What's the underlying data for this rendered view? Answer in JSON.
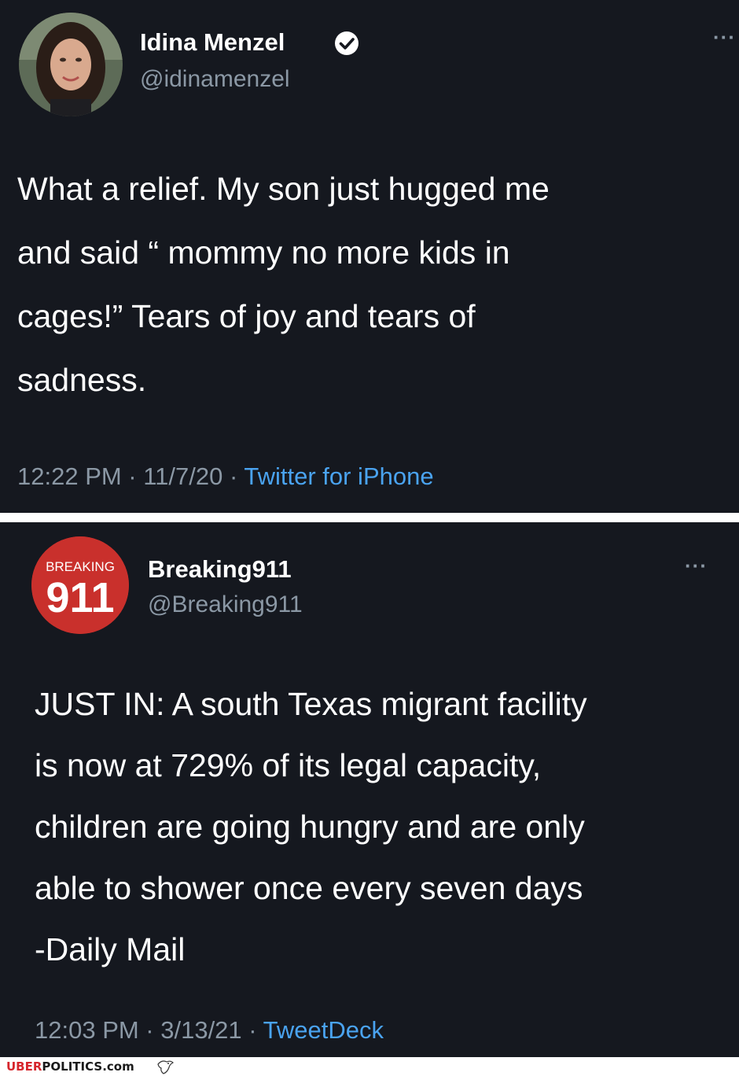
{
  "tweets": [
    {
      "display_name": "Idina Menzel",
      "handle": "@idinamenzel",
      "verified": true,
      "text": "What a relief.  My son just hugged me\nand said “ mommy no more kids in\ncages!” Tears of joy and tears of\nsadness.",
      "time": "12:22 PM · 11/7/20 · ",
      "source": "Twitter for iPhone",
      "more_icon": "···"
    },
    {
      "display_name": "Breaking911",
      "handle": "@Breaking911",
      "avatar_text_top": "BREAKING",
      "avatar_text_main": "911",
      "text": "JUST IN: A south Texas migrant facility\nis now at 729% of its legal capacity,\nchildren are going hungry and are only\nable to shower once every seven days\n-Daily Mail",
      "time": "12:03 PM · 3/13/21 · ",
      "source": "TweetDeck",
      "more_icon": "···"
    }
  ],
  "footer": {
    "brand_prefix": "UBER",
    "brand_suffix": "POLITICS.com"
  },
  "colors": {
    "background": "#15181f",
    "text": "#ffffff",
    "muted": "#8b98a5",
    "link": "#4aa3f0",
    "avatar_red": "#c9302c"
  }
}
